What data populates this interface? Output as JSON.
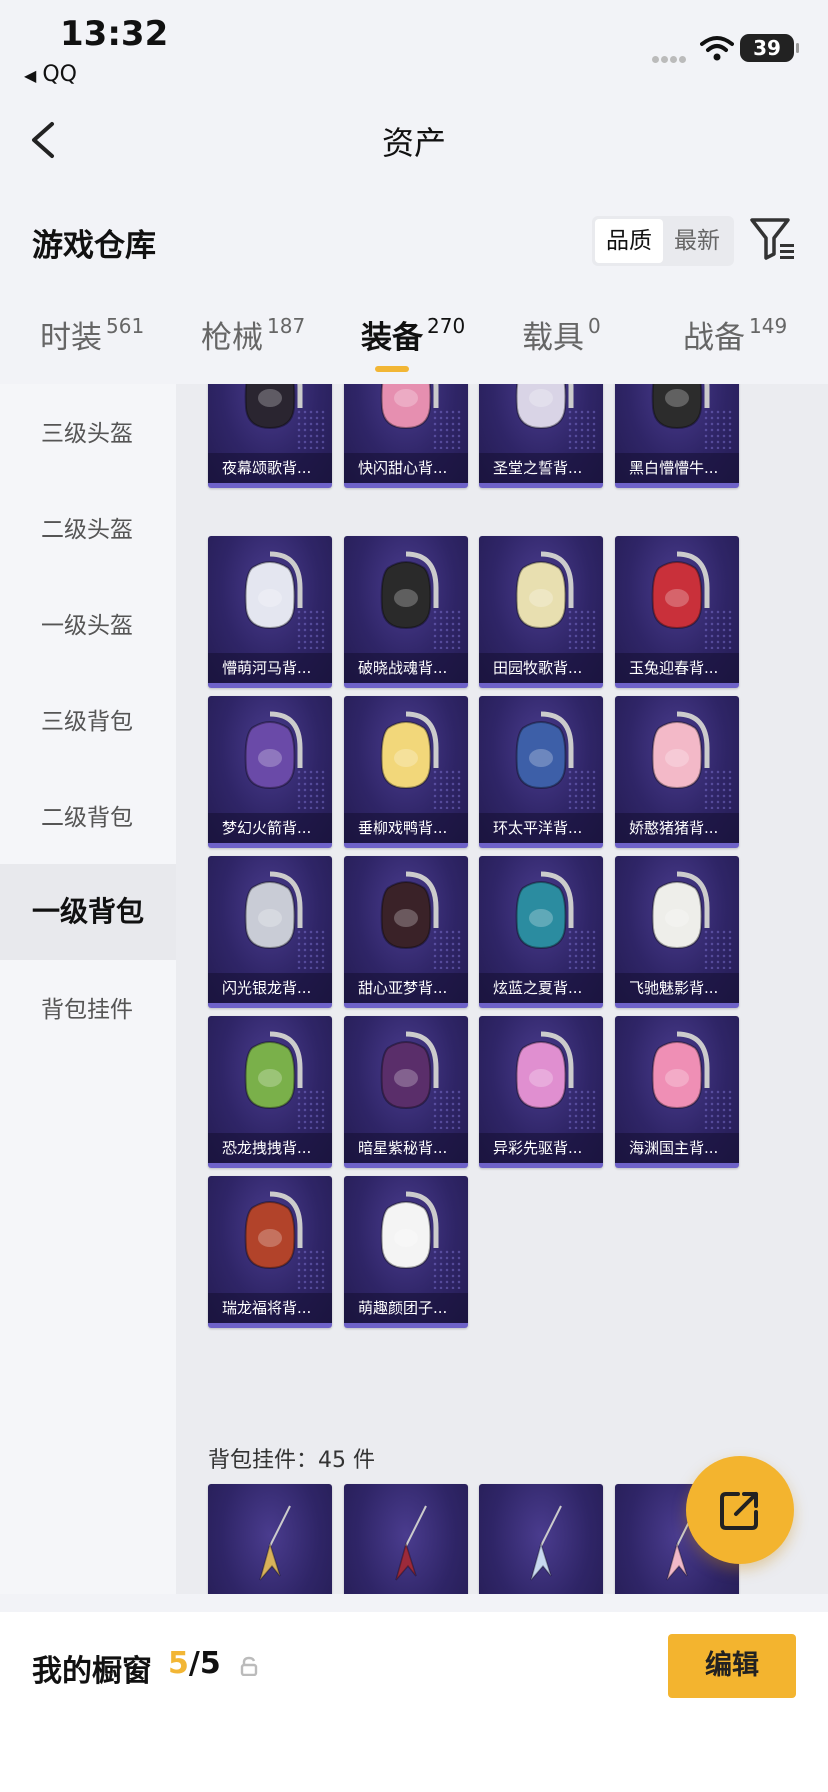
{
  "status_bar": {
    "time": "13:32",
    "back_app": "QQ",
    "battery": "39"
  },
  "nav": {
    "title": "资产"
  },
  "warehouse": {
    "title": "游戏仓库",
    "sort_options": [
      "品质",
      "最新"
    ],
    "active_sort": "品质"
  },
  "tabs": [
    {
      "label": "时装",
      "count": "561"
    },
    {
      "label": "枪械",
      "count": "187"
    },
    {
      "label": "装备",
      "count": "270",
      "active": true
    },
    {
      "label": "载具",
      "count": "0"
    },
    {
      "label": "战备",
      "count": "149"
    }
  ],
  "categories": [
    {
      "label": "三级头盔"
    },
    {
      "label": "二级头盔"
    },
    {
      "label": "一级头盔"
    },
    {
      "label": "三级背包"
    },
    {
      "label": "二级背包"
    },
    {
      "label": "一级背包",
      "active": true
    },
    {
      "label": "背包挂件"
    }
  ],
  "items": [
    {
      "name": "夜幕颂歌背...",
      "icon": "backpack-icon",
      "color": "#2a2530"
    },
    {
      "name": "快闪甜心背...",
      "icon": "backpack-icon",
      "color": "#e68fb0"
    },
    {
      "name": "圣堂之誓背...",
      "icon": "backpack-icon",
      "color": "#d9d4e6"
    },
    {
      "name": "黑白懵懵牛...",
      "icon": "backpack-icon",
      "color": "#2c2c2c"
    },
    {
      "name": "懵萌河马背...",
      "icon": "backpack-icon",
      "color": "#e4e6f0"
    },
    {
      "name": "破晓战魂背...",
      "icon": "backpack-icon",
      "color": "#2a2a2a"
    },
    {
      "name": "田园牧歌背...",
      "icon": "backpack-icon",
      "color": "#e8dfb0"
    },
    {
      "name": "玉兔迎春背...",
      "icon": "backpack-icon",
      "color": "#c9303a"
    },
    {
      "name": "梦幻火箭背...",
      "icon": "backpack-icon",
      "color": "#6a4aa8"
    },
    {
      "name": "垂柳戏鸭背...",
      "icon": "backpack-icon",
      "color": "#f2d77a"
    },
    {
      "name": "环太平洋背...",
      "icon": "backpack-icon",
      "color": "#3d5fa8"
    },
    {
      "name": "娇憨猪猪背...",
      "icon": "backpack-icon",
      "color": "#f3b9c8"
    },
    {
      "name": "闪光银龙背...",
      "icon": "backpack-icon",
      "color": "#c9ccd6"
    },
    {
      "name": "甜心亚梦背...",
      "icon": "backpack-icon",
      "color": "#3a2228"
    },
    {
      "name": "炫蓝之夏背...",
      "icon": "backpack-icon",
      "color": "#2b8ca0"
    },
    {
      "name": "飞驰魅影背...",
      "icon": "backpack-icon",
      "color": "#eeeeea"
    },
    {
      "name": "恐龙拽拽背...",
      "icon": "backpack-icon",
      "color": "#7ab04a"
    },
    {
      "name": "暗星紫秘背...",
      "icon": "backpack-icon",
      "color": "#5a2e6a"
    },
    {
      "name": "异彩先驱背...",
      "icon": "backpack-icon",
      "color": "#e08fd0"
    },
    {
      "name": "海渊国主背...",
      "icon": "backpack-icon",
      "color": "#ef8fb5"
    },
    {
      "name": "瑞龙福将背...",
      "icon": "backpack-icon",
      "color": "#b2432a"
    },
    {
      "name": "萌趣颜团子...",
      "icon": "backpack-icon",
      "color": "#f4f4f4"
    }
  ],
  "pendant_section": {
    "label": "背包挂件：45 件"
  },
  "pendants": [
    {
      "icon": "pendant-icon",
      "color": "#d9b25a"
    },
    {
      "icon": "pendant-icon",
      "color": "#9c2a3a"
    },
    {
      "icon": "pendant-icon",
      "color": "#c9d9ef"
    },
    {
      "icon": "pendant-icon",
      "color": "#f0b8c8"
    }
  ],
  "showcase": {
    "title": "我的橱窗",
    "current": "5",
    "separator": "/",
    "total": "5",
    "edit_label": "编辑"
  },
  "colors": {
    "accent": "#f3b42f",
    "card_bg": "#2f2567"
  }
}
